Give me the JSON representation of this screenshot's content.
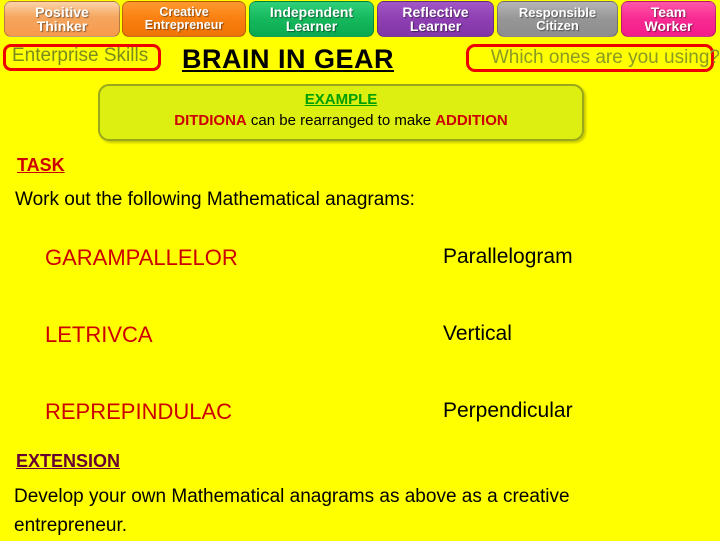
{
  "page": {
    "background_color": "#ffff00",
    "title": "BRAIN IN GEAR"
  },
  "tabs": [
    {
      "line1": "Positive",
      "line2": "Thinker",
      "color": "#f5a55e"
    },
    {
      "line1": "Creative",
      "line2": "Entrepreneur",
      "color": "#f97f10"
    },
    {
      "line1": "Independent",
      "line2": "Learner",
      "color": "#16b85d"
    },
    {
      "line1": "Reflective",
      "line2": "Learner",
      "color": "#8e3fb2"
    },
    {
      "line1": "Responsible",
      "line2": "Citizen",
      "color": "#969696"
    },
    {
      "line1": "Team",
      "line2": "Worker",
      "color": "#f82a92"
    }
  ],
  "header": {
    "enterprise_skills_label": "Enterprise Skills",
    "enterprise_skills_color": "#7a8a1e",
    "title": "BRAIN IN GEAR",
    "question": "Which ones are you using?",
    "question_color": "#8a9a22",
    "box_border_color": "#ee0000"
  },
  "example": {
    "heading": "EXAMPLE",
    "heading_color": "#00a000",
    "scrambled": "DITDIONA",
    "middle_text": " can be rearranged to make ",
    "answer": "ADDITION",
    "word_color": "#cc0000",
    "fill_color": "#ddee11",
    "border_color": "#9aa81c"
  },
  "task": {
    "heading": "TASK",
    "heading_color": "#cc0000",
    "instruction": "Work out the following Mathematical anagrams:",
    "rows": [
      {
        "scrambled": "GARAMPALLELOR",
        "answer": "Parallelogram"
      },
      {
        "scrambled": "LETRIVCA",
        "answer": "Vertical"
      },
      {
        "scrambled": "REPREPINDULAC",
        "answer": "Perpendicular"
      }
    ],
    "scrambled_color": "#cc0000",
    "answer_color": "#000000"
  },
  "extension": {
    "heading": "EXTENSION",
    "heading_color": "#660033",
    "text": "Develop your own Mathematical anagrams as above as a creative entrepreneur."
  }
}
